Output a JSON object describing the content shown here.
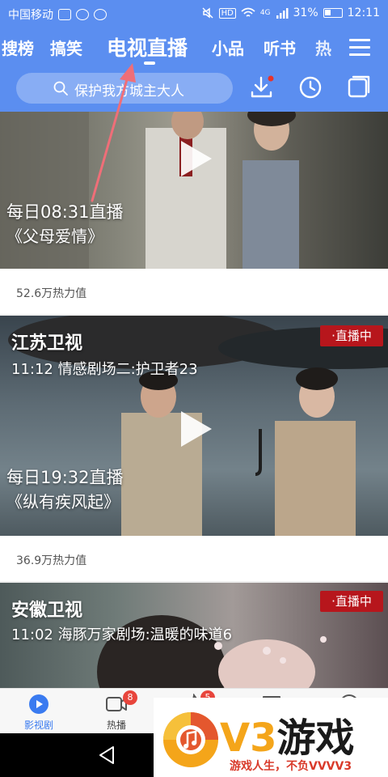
{
  "status_bar": {
    "carrier": "中国移动",
    "signal_tag": "HD",
    "network": "4G",
    "battery": "31%",
    "time": "12:11"
  },
  "tabs": [
    {
      "label": "搜榜",
      "active": false
    },
    {
      "label": "搞笑",
      "active": false
    },
    {
      "label": "电视直播",
      "active": true
    },
    {
      "label": "小品",
      "active": false
    },
    {
      "label": "听书",
      "active": false
    },
    {
      "label": "热",
      "active": false
    }
  ],
  "search": {
    "placeholder": "保护我方城主大人"
  },
  "header_icons": [
    "download-icon",
    "history-icon",
    "window-icon"
  ],
  "cards": [
    {
      "channel": "",
      "program": "",
      "schedule": "每日08:31直播",
      "show": "《父母爱情》",
      "live_badge": "",
      "heat": "52.6万热力值"
    },
    {
      "channel": "江苏卫视",
      "program": "11:12 情感剧场二:护卫者23",
      "schedule": "每日19:32直播",
      "show": "《纵有疾风起》",
      "live_badge": "·直播中",
      "heat": "36.9万热力值"
    },
    {
      "channel": "安徽卫视",
      "program": "11:02 海豚万家剧场:温暖的味道6",
      "schedule": "",
      "show": "",
      "live_badge": "·直播中",
      "heat": ""
    }
  ],
  "bottom_nav": [
    {
      "label": "影视剧",
      "icon": "play-circle-icon",
      "active": true,
      "badge": ""
    },
    {
      "label": "热播",
      "icon": "video-camera-icon",
      "active": false,
      "badge": "8"
    },
    {
      "label": "",
      "icon": "fire-icon",
      "active": false,
      "badge": "5"
    },
    {
      "label": "",
      "icon": "chat-icon",
      "active": false,
      "badge": ""
    },
    {
      "label": "",
      "icon": "face-icon",
      "active": false,
      "badge": ""
    }
  ],
  "watermark": {
    "brand_v3": "V3",
    "brand_game": "游戏",
    "slogan": "游戏人生，不负VVVV3"
  },
  "colors": {
    "header_blue": "#5b8ef0",
    "live_red": "#b7161c",
    "accent_blue": "#3a7bf0",
    "badge_red": "#e8453c",
    "brand_orange": "#f4a51a"
  }
}
